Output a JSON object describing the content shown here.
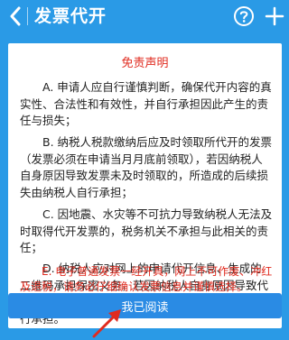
{
  "header": {
    "title": "发票代开",
    "back_icon": "chevron-left-icon",
    "help_icon": "question-circle-icon",
    "add_icon": "plus-icon"
  },
  "disclaimer": {
    "title": "免责声明",
    "paragraphs": [
      "　　A. 申请人应自行谨慎判断，确保代开内容的真实性、合法性和有效性，并自行承担因此产生的责任与损失；",
      "　　B. 纳税人税款缴纳后应及时领取所代开的发票（发票必须在申请当月月底前领取），若因纳税人自身原因导致发票未及时领取的，所造成的后续损失由纳税人自行承担；",
      "　　C. 因地震、水灾等不可抗力导致纳税人无法及时取得代开发票的，税务机关不承担与此相关的责任；",
      "　　D. 纳税人应对网上的申请代开信息、生成的二维码承担保密义务，若因纳税人自身原因导致代开信息泄露，所导致的相关责任与损失由纳税人自行承担。"
    ],
    "warning": "　　E. 电子普通发票一经开具，网上不可作废、冲红及退税，请务必仔细确认发票信息并谨慎选择。"
  },
  "actions": {
    "read_button": "我已阅读"
  },
  "colors": {
    "primary": "#2a9ae6",
    "button": "#2a8be4",
    "warning": "#e02b1f"
  }
}
